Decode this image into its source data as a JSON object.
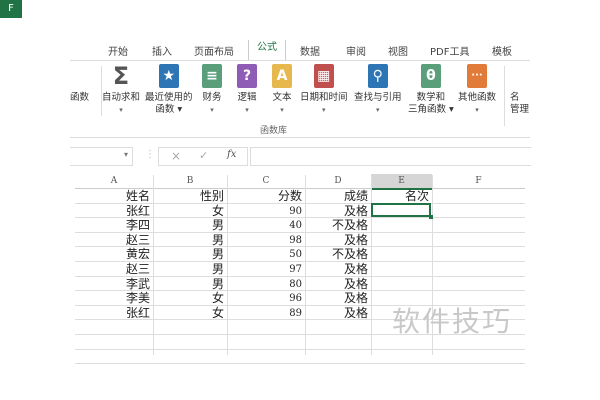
{
  "tabs": [
    {
      "label": "F"
    },
    {
      "label": "开始"
    },
    {
      "label": "插入"
    },
    {
      "label": "页面布局"
    },
    {
      "label": "公式"
    },
    {
      "label": "数据"
    },
    {
      "label": "审阅"
    },
    {
      "label": "视图"
    },
    {
      "label": "PDF工具"
    },
    {
      "label": "模板"
    }
  ],
  "ribbon": {
    "buttons": [
      {
        "label": "函数",
        "line2": ""
      },
      {
        "label": "自动求和",
        "line2": "▾",
        "icon": "Σ",
        "color": "#555555"
      },
      {
        "label": "最近使用的",
        "line2": "函数 ▾",
        "icon": "★",
        "color": "#2e75b6"
      },
      {
        "label": "财务",
        "line2": "▾",
        "icon": "≡",
        "color": "#5a9e7a"
      },
      {
        "label": "逻辑",
        "line2": "▾",
        "icon": "?",
        "color": "#8e5bb5"
      },
      {
        "label": "文本",
        "line2": "▾",
        "icon": "A",
        "color": "#e6b84d"
      },
      {
        "label": "日期和时间",
        "line2": "▾",
        "icon": "▦",
        "color": "#c0504d"
      },
      {
        "label": "查找与引用",
        "line2": "▾",
        "icon": "⚲",
        "color": "#2e75b6"
      },
      {
        "label": "数学和",
        "line2": "三角函数 ▾",
        "icon": "θ",
        "color": "#5a9e7a"
      },
      {
        "label": "其他函数",
        "line2": "▾",
        "icon": "···",
        "color": "#e07b39"
      },
      {
        "label": "名",
        "line2": "管理"
      }
    ],
    "group_label": "函数库"
  },
  "formula_bar": {
    "cancel": "×",
    "enter": "✓",
    "fx": "fx",
    "value": ""
  },
  "columns": [
    "A",
    "B",
    "C",
    "D",
    "E",
    "F"
  ],
  "rows": [
    [
      "姓名",
      "性别",
      "分数",
      "成绩",
      "名次"
    ],
    [
      "张红",
      "女",
      "90",
      "及格",
      ""
    ],
    [
      "李四",
      "男",
      "40",
      "不及格",
      ""
    ],
    [
      "赵三",
      "男",
      "98",
      "及格",
      ""
    ],
    [
      "黄宏",
      "男",
      "50",
      "不及格",
      ""
    ],
    [
      "赵三",
      "男",
      "97",
      "及格",
      ""
    ],
    [
      "李武",
      "男",
      "80",
      "及格",
      ""
    ],
    [
      "李美",
      "女",
      "96",
      "及格",
      ""
    ],
    [
      "张红",
      "女",
      "89",
      "及格",
      ""
    ]
  ],
  "watermark": "软件技巧"
}
